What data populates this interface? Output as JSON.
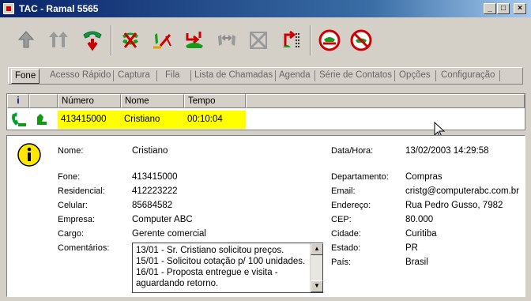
{
  "window": {
    "title": "TAC  - Ramal 5565",
    "controls": [
      "_",
      "□",
      "×"
    ]
  },
  "toolbar": {
    "buttons": [
      {
        "icon": "answer-call-icon"
      },
      {
        "icon": "answer-conference-icon"
      },
      {
        "icon": "hangup-icon"
      },
      {
        "icon": "reject-call-icon"
      },
      {
        "icon": "hold-call-icon"
      },
      {
        "icon": "transfer-call-icon"
      },
      {
        "icon": "pickup-icon"
      },
      {
        "icon": "conference-icon"
      },
      {
        "icon": "redirect-call-icon"
      },
      {
        "icon": "do-not-disturb-icon"
      },
      {
        "icon": "block-calls-icon"
      }
    ]
  },
  "tabs": [
    {
      "label": "Fone",
      "active": true
    },
    {
      "label": "Acesso Rápido"
    },
    {
      "label": "Captura"
    },
    {
      "label": "Fila"
    },
    {
      "label": "Lista de Chamadas"
    },
    {
      "label": "Agenda"
    },
    {
      "label": "Série de Contatos"
    },
    {
      "label": "Opções"
    },
    {
      "label": "Configuração"
    }
  ],
  "call_list": {
    "columns": {
      "info": "i",
      "numero": "Número",
      "nome": "Nome",
      "tempo": "Tempo"
    },
    "rows": [
      {
        "numero": "413415000",
        "nome": "Cristiano",
        "tempo": "00:10:04"
      }
    ]
  },
  "detail": {
    "left": [
      {
        "label": "Nome:",
        "value": "Cristiano"
      },
      {
        "label": "Fone:",
        "value": "413415000"
      },
      {
        "label": "Residencial:",
        "value": "412223222"
      },
      {
        "label": "Celular:",
        "value": "85684582"
      },
      {
        "label": "Empresa:",
        "value": "Computer ABC"
      },
      {
        "label": "Cargo:",
        "value": "Gerente comercial"
      },
      {
        "label": "Comentários:"
      }
    ],
    "comments": [
      "13/01 - Sr. Cristiano solicitou preços.",
      "15/01 - Solicitou  cotação p/ 100 unidades.",
      "16/01 - Proposta entregue e visita -",
      "aguardando retorno."
    ],
    "right": [
      {
        "label": "Data/Hora:",
        "value": "13/02/2003 14:29:58"
      },
      {
        "label": "Departamento:",
        "value": "Compras"
      },
      {
        "label": "Email:",
        "value": "cristg@computerabc.com.br"
      },
      {
        "label": "Endereço:",
        "value": "Rua Pedro Gusso, 7982"
      },
      {
        "label": "CEP:",
        "value": "80.000"
      },
      {
        "label": "Cidade:",
        "value": "Curitiba"
      },
      {
        "label": "Estado:",
        "value": "PR"
      },
      {
        "label": "País:",
        "value": "Brasil"
      }
    ]
  },
  "colors": {
    "titlebar": "#0a246a",
    "highlight_row": "#ffff00",
    "icon_red": "#cc0000",
    "icon_green": "#119911"
  }
}
